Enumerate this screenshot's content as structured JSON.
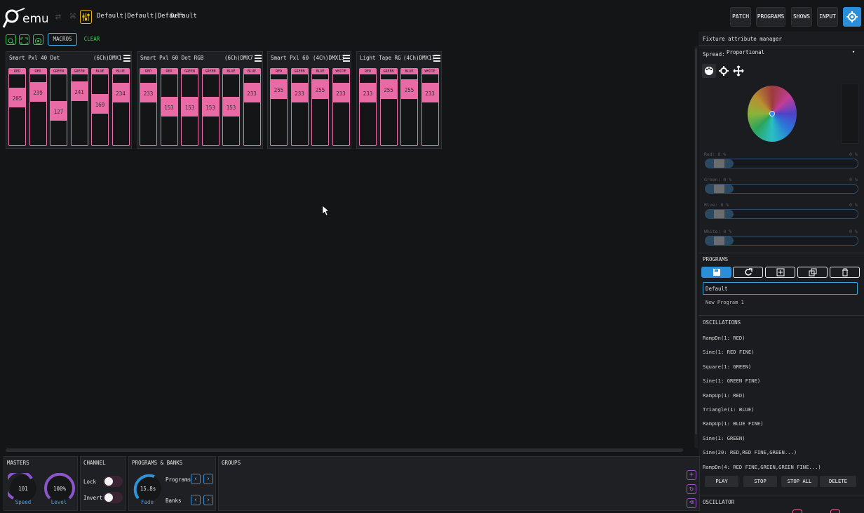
{
  "topbar": {
    "path": "Default|Default|Default",
    "show": "Default",
    "buttons": [
      "PATCH",
      "PROGRAMS",
      "SHOWS",
      "INPUT"
    ],
    "icons": [
      "usb-icon",
      "network-icon",
      "show-settings-icon",
      "settings-icon"
    ]
  },
  "toolbar": {
    "macros_label": "MACROS",
    "clear_label": "CLEAR"
  },
  "fixtures": [
    {
      "name": "Smart Pxl 40 Dot",
      "info": "(6Ch)DMX1",
      "channels": [
        {
          "label": "RED",
          "value": 205
        },
        {
          "label": "RED",
          "value": 239
        },
        {
          "label": "GREEN",
          "value": 127
        },
        {
          "label": "GREEN",
          "value": 241
        },
        {
          "label": "BLUE",
          "value": 169
        },
        {
          "label": "BLUE",
          "value": 234
        }
      ]
    },
    {
      "name": "Smart Pxl 60 Dot RGB",
      "info": "(6Ch)DMX7",
      "channels": [
        {
          "label": "RED",
          "value": 233
        },
        {
          "label": "RED",
          "value": 153
        },
        {
          "label": "GREEN",
          "value": 153
        },
        {
          "label": "GREEN",
          "value": 153
        },
        {
          "label": "BLUE",
          "value": 153
        },
        {
          "label": "BLUE",
          "value": 233
        }
      ]
    },
    {
      "name": "Smart Pxl 60",
      "info": "(4Ch)DMX13",
      "channels": [
        {
          "label": "RED",
          "value": 255
        },
        {
          "label": "GREEN",
          "value": 233
        },
        {
          "label": "BLUE",
          "value": 255
        },
        {
          "label": "WHITE",
          "value": 233
        }
      ]
    },
    {
      "name": "Light Tape RG",
      "info": "(4Ch)DMX17",
      "channels": [
        {
          "label": "RED",
          "value": 233
        },
        {
          "label": "GREEN",
          "value": 255
        },
        {
          "label": "BLUE",
          "value": 255
        },
        {
          "label": "WHITE",
          "value": 233
        }
      ]
    }
  ],
  "attribute_manager": {
    "title": "Fixture attribute manager",
    "spread_label": "Spread:",
    "spread_value": "Proportional",
    "tabs": [
      "palette-icon",
      "gear-icon",
      "move-icon"
    ],
    "sliders": [
      {
        "name": "Red:",
        "value": "0 %",
        "right": "0 %",
        "level": 0
      },
      {
        "name": "Green:",
        "value": "0 %",
        "right": "0 %",
        "level": 0
      },
      {
        "name": "Blue:",
        "value": "0 %",
        "right": "0 %",
        "level": 0
      },
      {
        "name": "White:",
        "value": "0 %",
        "right": "0 %",
        "level": 0
      }
    ]
  },
  "programs": {
    "title": "PROGRAMS",
    "actions": [
      "save-icon",
      "reload-icon",
      "add-icon",
      "copy-icon",
      "trash-icon"
    ],
    "selected": "Default",
    "items": [
      "New Program 1"
    ]
  },
  "oscillations": {
    "title": "OSCILLATIONS",
    "items": [
      "RampDn(1: RED)",
      "Sine(1: RED FINE)",
      "Square(1: GREEN)",
      "Sine(1: GREEN FINE)",
      "RampUp(1: RED)",
      "Triangle(1: BLUE)",
      "RampUp(1: BLUE FINE)",
      "Sine(1: GREEN)",
      "Sine(20: RED,RED FINE,GREEN...)",
      "RampDn(4: RED FINE,GREEN,GREEN FINE...)"
    ],
    "buttons": [
      "PLAY",
      "STOP",
      "STOP ALL",
      "DELETE"
    ]
  },
  "oscillator": {
    "title": "OSCILLATOR"
  },
  "masters": {
    "title": "MASTERS",
    "speed_value": "101",
    "speed_label": "Speed",
    "level_value": "100%",
    "level_label": "Level"
  },
  "channel": {
    "title": "CHANNEL",
    "lock_label": "Lock",
    "invert_label": "Invert"
  },
  "programs_banks": {
    "title": "PROGRAMS & BANKS",
    "fade_value": "15.8s",
    "fade_label": "Fade",
    "programs_label": "Programs",
    "banks_label": "Banks"
  },
  "groups": {
    "title": "GROUPS"
  },
  "colors": {
    "accent": "#2b8ed8",
    "fader": "#ea6aa5",
    "green": "#43cb5c"
  }
}
